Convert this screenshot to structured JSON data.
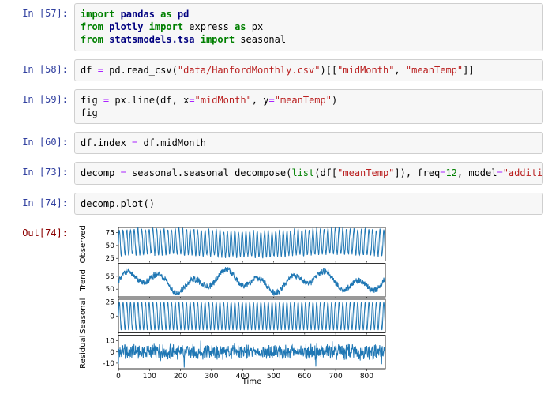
{
  "cells": [
    {
      "prompt": "In [57]:",
      "tokens": [
        {
          "t": "import ",
          "c": "kw"
        },
        {
          "t": "pandas ",
          "c": "kn"
        },
        {
          "t": "as ",
          "c": "kw"
        },
        {
          "t": "pd",
          "c": "kn"
        },
        {
          "t": "\n",
          "c": ""
        },
        {
          "t": "from ",
          "c": "kw"
        },
        {
          "t": "plotly ",
          "c": "kn"
        },
        {
          "t": "import ",
          "c": "kw"
        },
        {
          "t": "express ",
          "c": "nm"
        },
        {
          "t": "as ",
          "c": "kw"
        },
        {
          "t": "px",
          "c": "nm"
        },
        {
          "t": "\n",
          "c": ""
        },
        {
          "t": "from ",
          "c": "kw"
        },
        {
          "t": "statsmodels.tsa ",
          "c": "kn"
        },
        {
          "t": "import ",
          "c": "kw"
        },
        {
          "t": "seasonal",
          "c": "nm"
        }
      ]
    },
    {
      "prompt": "In [58]:",
      "tokens": [
        {
          "t": "df ",
          "c": "nm"
        },
        {
          "t": "= ",
          "c": "op"
        },
        {
          "t": "pd",
          "c": "nm"
        },
        {
          "t": ".",
          "c": ""
        },
        {
          "t": "read_csv",
          "c": "nm"
        },
        {
          "t": "(",
          "c": ""
        },
        {
          "t": "\"data/HanfordMonthly.csv\"",
          "c": "str"
        },
        {
          "t": ")",
          "c": ""
        },
        {
          "t": "[[",
          "c": ""
        },
        {
          "t": "\"midMonth\"",
          "c": "str"
        },
        {
          "t": ", ",
          "c": ""
        },
        {
          "t": "\"meanTemp\"",
          "c": "str"
        },
        {
          "t": "]]",
          "c": ""
        }
      ]
    },
    {
      "prompt": "In [59]:",
      "tokens": [
        {
          "t": "fig ",
          "c": "nm"
        },
        {
          "t": "= ",
          "c": "op"
        },
        {
          "t": "px",
          "c": "nm"
        },
        {
          "t": ".",
          "c": ""
        },
        {
          "t": "line",
          "c": "nm"
        },
        {
          "t": "(df, x",
          "c": ""
        },
        {
          "t": "=",
          "c": "op"
        },
        {
          "t": "\"midMonth\"",
          "c": "str"
        },
        {
          "t": ", y",
          "c": ""
        },
        {
          "t": "=",
          "c": "op"
        },
        {
          "t": "\"meanTemp\"",
          "c": "str"
        },
        {
          "t": ")",
          "c": ""
        },
        {
          "t": "\n",
          "c": ""
        },
        {
          "t": "fig",
          "c": "nm"
        }
      ]
    },
    {
      "prompt": "In [60]:",
      "tokens": [
        {
          "t": "df",
          "c": "nm"
        },
        {
          "t": ".",
          "c": ""
        },
        {
          "t": "index ",
          "c": "nm"
        },
        {
          "t": "= ",
          "c": "op"
        },
        {
          "t": "df",
          "c": "nm"
        },
        {
          "t": ".",
          "c": ""
        },
        {
          "t": "midMonth",
          "c": "nm"
        }
      ]
    },
    {
      "prompt": "In [73]:",
      "tokens": [
        {
          "t": "decomp ",
          "c": "nm"
        },
        {
          "t": "= ",
          "c": "op"
        },
        {
          "t": "seasonal",
          "c": "nm"
        },
        {
          "t": ".",
          "c": ""
        },
        {
          "t": "seasonal_decompose",
          "c": "nm"
        },
        {
          "t": "(",
          "c": ""
        },
        {
          "t": "list",
          "c": "builtin"
        },
        {
          "t": "(df[",
          "c": ""
        },
        {
          "t": "\"meanTemp\"",
          "c": "str"
        },
        {
          "t": "]), freq",
          "c": ""
        },
        {
          "t": "=",
          "c": "op"
        },
        {
          "t": "12",
          "c": "num"
        },
        {
          "t": ", model",
          "c": ""
        },
        {
          "t": "=",
          "c": "op"
        },
        {
          "t": "\"additive\"",
          "c": "str"
        },
        {
          "t": ")",
          "c": ""
        }
      ]
    },
    {
      "prompt": "In [74]:",
      "tokens": [
        {
          "t": "decomp",
          "c": "nm"
        },
        {
          "t": ".",
          "c": ""
        },
        {
          "t": "plot",
          "c": "nm"
        },
        {
          "t": "()",
          "c": ""
        }
      ]
    }
  ],
  "output_prompt": "Out[74]:",
  "chart_data": {
    "type": "line",
    "panels": [
      {
        "name": "Observed",
        "yticks": [
          25,
          50,
          75
        ],
        "ylim": [
          20,
          85
        ],
        "n": 860,
        "period": 12,
        "base": 55,
        "amp": 25,
        "noise": 3,
        "trend_variation": 3,
        "render": "seasonal"
      },
      {
        "name": "Trend",
        "yticks": [
          50,
          55
        ],
        "ylim": [
          47,
          60
        ],
        "n": 860,
        "base": 53,
        "amp": 3.5,
        "period": 45,
        "noise": 1.2,
        "render": "trend"
      },
      {
        "name": "Seasonal",
        "yticks": [
          0,
          25
        ],
        "ylim": [
          -30,
          30
        ],
        "n": 860,
        "period": 12,
        "base": 0,
        "amp": 25,
        "noise": 0,
        "render": "pure_seasonal"
      },
      {
        "name": "Residual",
        "yticks": [
          -10,
          0,
          10
        ],
        "ylim": [
          -15,
          15
        ],
        "n": 860,
        "base": 0,
        "amp": 0,
        "noise": 5,
        "render": "residual"
      }
    ],
    "x": {
      "min": 0,
      "max": 860,
      "ticks": [
        0,
        100,
        200,
        300,
        400,
        500,
        600,
        700,
        800
      ],
      "label": "Time"
    },
    "colors": {
      "series": "#1f77b4"
    }
  }
}
